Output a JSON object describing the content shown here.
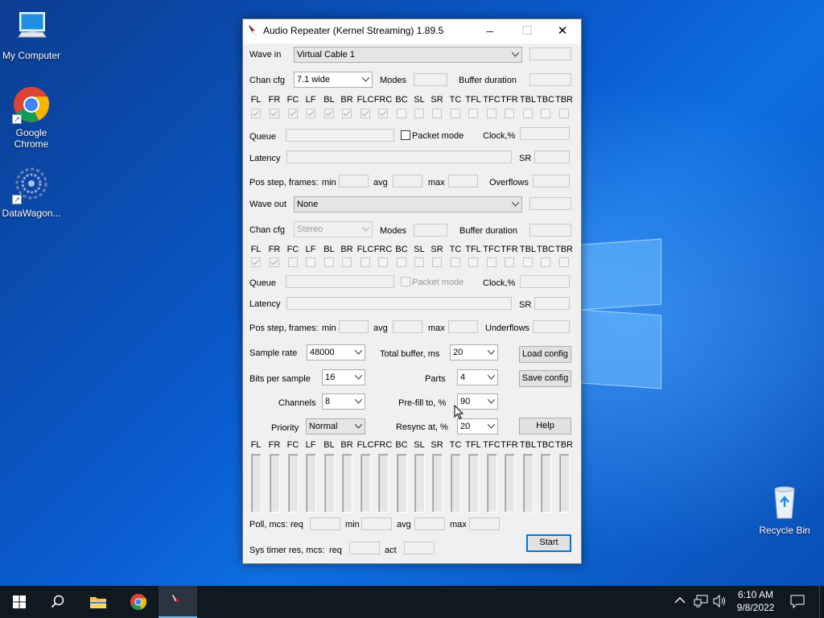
{
  "desktop": {
    "icons": [
      {
        "label": "My Computer"
      },
      {
        "label": "Google Chrome"
      },
      {
        "label": "DataWagon..."
      },
      {
        "label": "Recycle Bin"
      }
    ]
  },
  "window": {
    "title": "Audio Repeater (Kernel Streaming) 1.89.5",
    "minimize": "─",
    "maximize": "☐",
    "close": "✕"
  },
  "wave_in": {
    "label": "Wave in",
    "device": "Virtual Cable 1",
    "chan_cfg_label": "Chan cfg",
    "chan_cfg": "7.1 wide",
    "modes_label": "Modes",
    "buffer_duration_label": "Buffer duration",
    "channels": [
      {
        "name": "FL",
        "checked": true
      },
      {
        "name": "FR",
        "checked": true
      },
      {
        "name": "FC",
        "checked": true
      },
      {
        "name": "LF",
        "checked": true
      },
      {
        "name": "BL",
        "checked": true
      },
      {
        "name": "BR",
        "checked": true
      },
      {
        "name": "FLC",
        "checked": true
      },
      {
        "name": "FRC",
        "checked": true
      },
      {
        "name": "BC",
        "checked": false
      },
      {
        "name": "SL",
        "checked": false
      },
      {
        "name": "SR",
        "checked": false
      },
      {
        "name": "TC",
        "checked": false
      },
      {
        "name": "TFL",
        "checked": false
      },
      {
        "name": "TFC",
        "checked": false
      },
      {
        "name": "TFR",
        "checked": false
      },
      {
        "name": "TBL",
        "checked": false
      },
      {
        "name": "TBC",
        "checked": false
      },
      {
        "name": "TBR",
        "checked": false
      }
    ],
    "queue_label": "Queue",
    "packet_mode_label": "Packet mode",
    "clock_label": "Clock,%",
    "latency_label": "Latency",
    "sr_label": "SR",
    "pos_step_label": "Pos step, frames:",
    "min_label": "min",
    "avg_label": "avg",
    "max_label": "max",
    "overflows_label": "Overflows"
  },
  "wave_out": {
    "label": "Wave out",
    "device": "None",
    "chan_cfg_label": "Chan cfg",
    "chan_cfg": "Stereo",
    "modes_label": "Modes",
    "buffer_duration_label": "Buffer duration",
    "channels": [
      {
        "name": "FL",
        "checked": true
      },
      {
        "name": "FR",
        "checked": true
      },
      {
        "name": "FC",
        "checked": false
      },
      {
        "name": "LF",
        "checked": false
      },
      {
        "name": "BL",
        "checked": false
      },
      {
        "name": "BR",
        "checked": false
      },
      {
        "name": "FLC",
        "checked": false
      },
      {
        "name": "FRC",
        "checked": false
      },
      {
        "name": "BC",
        "checked": false
      },
      {
        "name": "SL",
        "checked": false
      },
      {
        "name": "SR",
        "checked": false
      },
      {
        "name": "TC",
        "checked": false
      },
      {
        "name": "TFL",
        "checked": false
      },
      {
        "name": "TFC",
        "checked": false
      },
      {
        "name": "TFR",
        "checked": false
      },
      {
        "name": "TBL",
        "checked": false
      },
      {
        "name": "TBC",
        "checked": false
      },
      {
        "name": "TBR",
        "checked": false
      }
    ],
    "queue_label": "Queue",
    "packet_mode_label": "Packet mode",
    "clock_label": "Clock,%",
    "latency_label": "Latency",
    "sr_label": "SR",
    "pos_step_label": "Pos step, frames:",
    "min_label": "min",
    "avg_label": "avg",
    "max_label": "max",
    "underflows_label": "Underflows"
  },
  "settings": {
    "sample_rate_label": "Sample rate",
    "sample_rate": "48000",
    "bits_label": "Bits per sample",
    "bits": "16",
    "channels_label": "Channels",
    "channels": "8",
    "priority_label": "Priority",
    "priority": "Normal",
    "total_buffer_label": "Total buffer, ms",
    "total_buffer": "20",
    "parts_label": "Parts",
    "parts": "4",
    "prefill_label": "Pre-fill to, %",
    "prefill": "90",
    "resync_label": "Resync at, %",
    "resync": "20",
    "load_config": "Load config",
    "save_config": "Save config",
    "help": "Help"
  },
  "meters": {
    "channels": [
      "FL",
      "FR",
      "FC",
      "LF",
      "BL",
      "BR",
      "FLC",
      "FRC",
      "BC",
      "SL",
      "SR",
      "TC",
      "TFL",
      "TFC",
      "TFR",
      "TBL",
      "TBC",
      "TBR"
    ]
  },
  "poll": {
    "label": "Poll, mcs:",
    "req_label": "req",
    "min_label": "min",
    "avg_label": "avg",
    "max_label": "max"
  },
  "sys_timer": {
    "label": "Sys timer res, mcs:",
    "req_label": "req",
    "act_label": "act"
  },
  "start_button": "Start",
  "taskbar": {
    "time": "6:10 AM",
    "date": "9/8/2022"
  }
}
